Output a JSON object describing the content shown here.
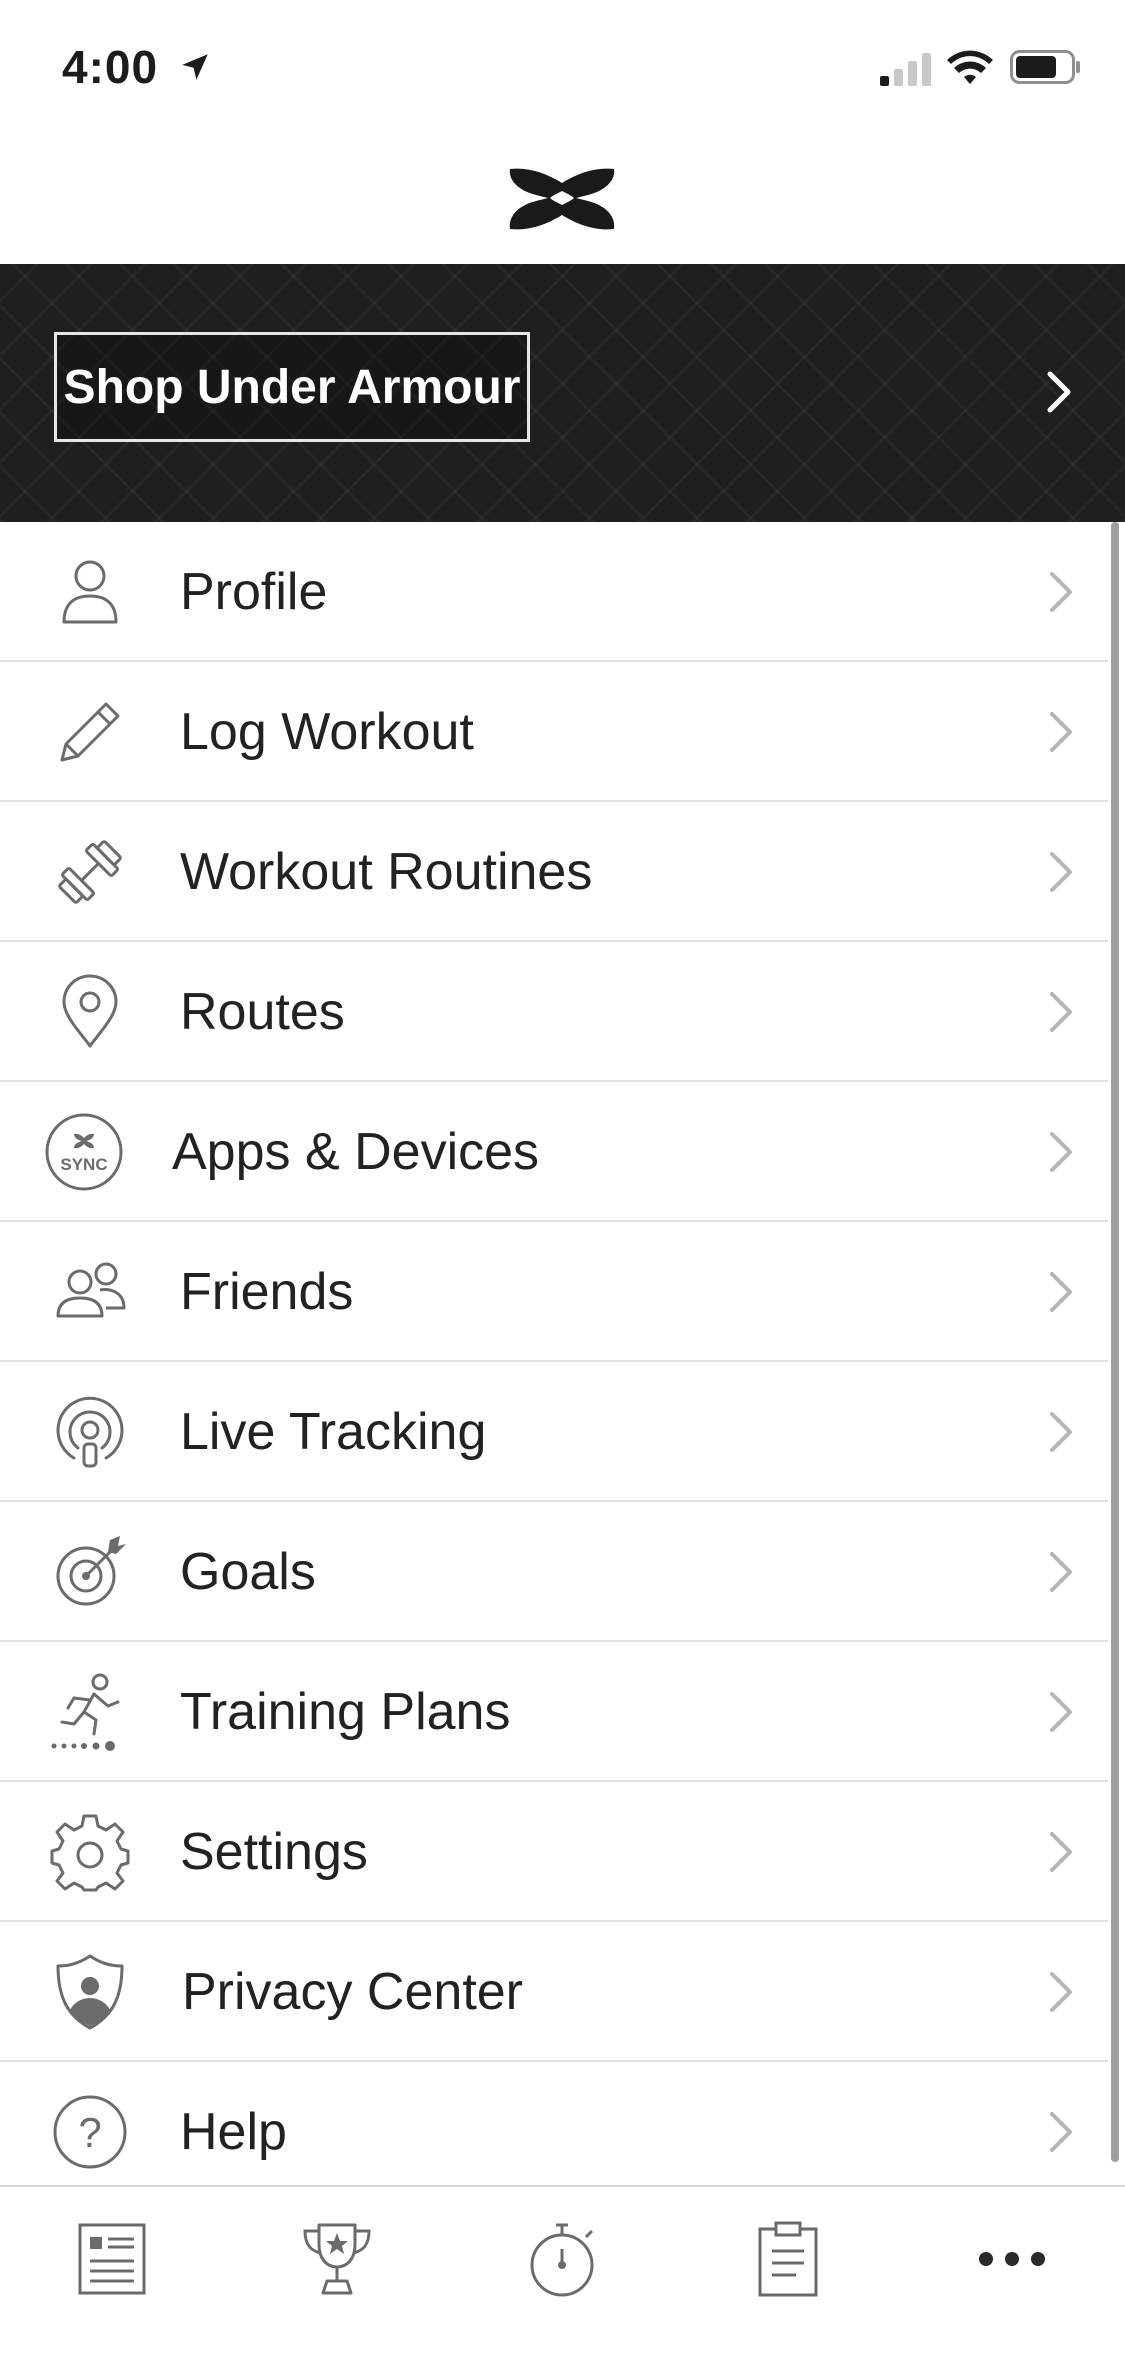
{
  "status_bar": {
    "time": "4:00",
    "icons": [
      "location-arrow-icon",
      "cellular-signal-icon",
      "wifi-icon",
      "battery-icon"
    ]
  },
  "brand": {
    "logo": "under-armour-logo"
  },
  "banner": {
    "shop_label": "Shop Under Armour",
    "chevron": "chevron-right-icon"
  },
  "menu": {
    "items": [
      {
        "label": "Profile",
        "icon": "profile-icon"
      },
      {
        "label": "Log Workout",
        "icon": "pencil-icon"
      },
      {
        "label": "Workout Routines",
        "icon": "dumbbell-icon"
      },
      {
        "label": "Routes",
        "icon": "map-pin-icon"
      },
      {
        "label": "Apps & Devices",
        "icon": "sync-icon",
        "icon_text": "SYNC"
      },
      {
        "label": "Friends",
        "icon": "friends-icon"
      },
      {
        "label": "Live Tracking",
        "icon": "live-tracking-icon"
      },
      {
        "label": "Goals",
        "icon": "target-icon"
      },
      {
        "label": "Training Plans",
        "icon": "runner-icon"
      },
      {
        "label": "Settings",
        "icon": "gear-icon"
      },
      {
        "label": "Privacy Center",
        "icon": "shield-icon"
      },
      {
        "label": "Help",
        "icon": "question-icon",
        "icon_text": "?"
      }
    ]
  },
  "tab_bar": {
    "tabs": [
      {
        "name": "feed",
        "icon": "feed-icon"
      },
      {
        "name": "challenges",
        "icon": "trophy-icon"
      },
      {
        "name": "record",
        "icon": "stopwatch-icon"
      },
      {
        "name": "plans",
        "icon": "clipboard-icon"
      },
      {
        "name": "more",
        "icon": "more-icon"
      }
    ],
    "selected": "more"
  },
  "colors": {
    "banner_bg": "#1f1f1f",
    "text": "#222222",
    "icon_gray": "#6b6b6b",
    "chevron_gray": "#b5b5b5",
    "divider": "#e2e2e2"
  }
}
